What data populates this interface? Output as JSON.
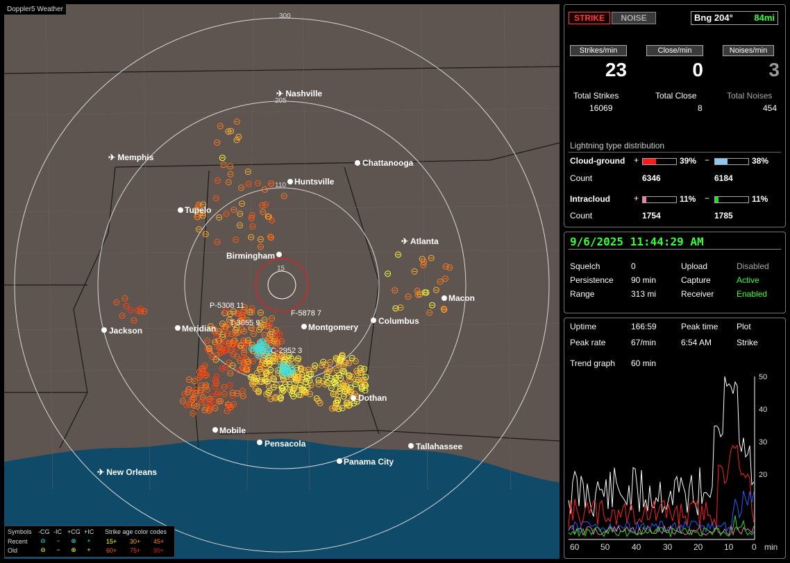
{
  "map": {
    "title": "Doppler5 Weather",
    "ranges": [
      "300",
      "205",
      "110",
      "15"
    ],
    "cities": [
      {
        "name": "Nashville",
        "type": "airport"
      },
      {
        "name": "Memphis",
        "type": "airport"
      },
      {
        "name": "Chattanooga",
        "type": "dot"
      },
      {
        "name": "Huntsville",
        "type": "dot"
      },
      {
        "name": "Tupelo",
        "type": "dot"
      },
      {
        "name": "Atlanta",
        "type": "airport"
      },
      {
        "name": "Birmingham",
        "type": "dot"
      },
      {
        "name": "Macon",
        "type": "dot"
      },
      {
        "name": "Jackson",
        "type": "dot"
      },
      {
        "name": "Meridian",
        "type": "dot"
      },
      {
        "name": "Montgomery",
        "type": "dot"
      },
      {
        "name": "Columbus",
        "type": "dot"
      },
      {
        "name": "Dothan",
        "type": "dot"
      },
      {
        "name": "Mobile",
        "type": "dot"
      },
      {
        "name": "Pensacola",
        "type": "dot"
      },
      {
        "name": "Tallahassee",
        "type": "dot"
      },
      {
        "name": "Panama City",
        "type": "dot"
      },
      {
        "name": "New Orleans",
        "type": "airport"
      }
    ],
    "storms": [
      {
        "id": "P-5308",
        "count": "11"
      },
      {
        "id": "T-3055",
        "count": "9"
      },
      {
        "id": "F-5878",
        "count": "7"
      },
      {
        "id": "C-2952",
        "count": "3"
      }
    ],
    "legend": {
      "symbols_label": "Symbols",
      "cols": [
        "-CG",
        "-IC",
        "+CG",
        "+IC"
      ],
      "recent_label": "Recent",
      "old_label": "Old",
      "age_title": "Strike age color codes",
      "age_recent": [
        "15+",
        "30+",
        "45+"
      ],
      "age_old": [
        "60+",
        "75+",
        "90+"
      ],
      "age_colors": [
        "#ffff40",
        "#ffb030",
        "#ff7a20",
        "#ff5a10",
        "#ff3c10",
        "#e02010"
      ]
    }
  },
  "stats": {
    "strike_button": "STRIKE",
    "noise_button": "NOISE",
    "bearing": "Bng 204°",
    "distance": "84mi",
    "headers": [
      "Strikes/min",
      "Close/min",
      "Noises/min"
    ],
    "per_min": [
      "23",
      "0",
      "3"
    ],
    "total_labels": [
      "Total Strikes",
      "Total Close",
      "Total Noises"
    ],
    "totals": [
      "16069",
      "8",
      "454"
    ],
    "distribution_title": "Lightning type distribution",
    "cloud_ground_label": "Cloud-ground",
    "intracloud_label": "Intracloud",
    "count_label": "Count",
    "plus": "+",
    "minus": "−",
    "cg_pos_pct": "39%",
    "cg_neg_pct": "38%",
    "cg_pos_count": "6346",
    "cg_neg_count": "6184",
    "ic_pos_pct": "11%",
    "ic_neg_pct": "11%",
    "ic_pos_count": "1754",
    "ic_neg_count": "1785",
    "bar_fractions": {
      "cg_pos": 0.39,
      "cg_neg": 0.38,
      "ic_pos": 0.11,
      "ic_neg": 0.11
    },
    "bar_colors": {
      "cg_pos": "#ff1a1a",
      "cg_neg": "#8ec8f0",
      "ic_pos": "#f07ab0",
      "ic_neg": "#20e020"
    }
  },
  "status": {
    "datetime": "9/6/2025 11:44:29 AM",
    "squelch_label": "Squelch",
    "squelch": "0",
    "persistence_label": "Persistence",
    "persistence": "90 min",
    "range_label": "Range",
    "range": "313 mi",
    "upload_label": "Upload",
    "upload": "Disabled",
    "capture_label": "Capture",
    "capture": "Active",
    "receiver_label": "Receiver",
    "receiver": "Enabled"
  },
  "trend": {
    "uptime_label": "Uptime",
    "uptime": "166:59",
    "peak_time_label": "Peak time",
    "peak_time": "6:54 AM",
    "plot_label": "Plot",
    "plot_value": "Strike",
    "peak_rate_label": "Peak rate",
    "peak_rate": "67/min",
    "trend_label": "Trend graph",
    "trend_value": "60 min",
    "y_ticks": [
      "50",
      "40",
      "30",
      "20"
    ],
    "x_ticks": [
      "60",
      "50",
      "40",
      "30",
      "20",
      "10",
      "0"
    ],
    "x_unit": "min"
  }
}
